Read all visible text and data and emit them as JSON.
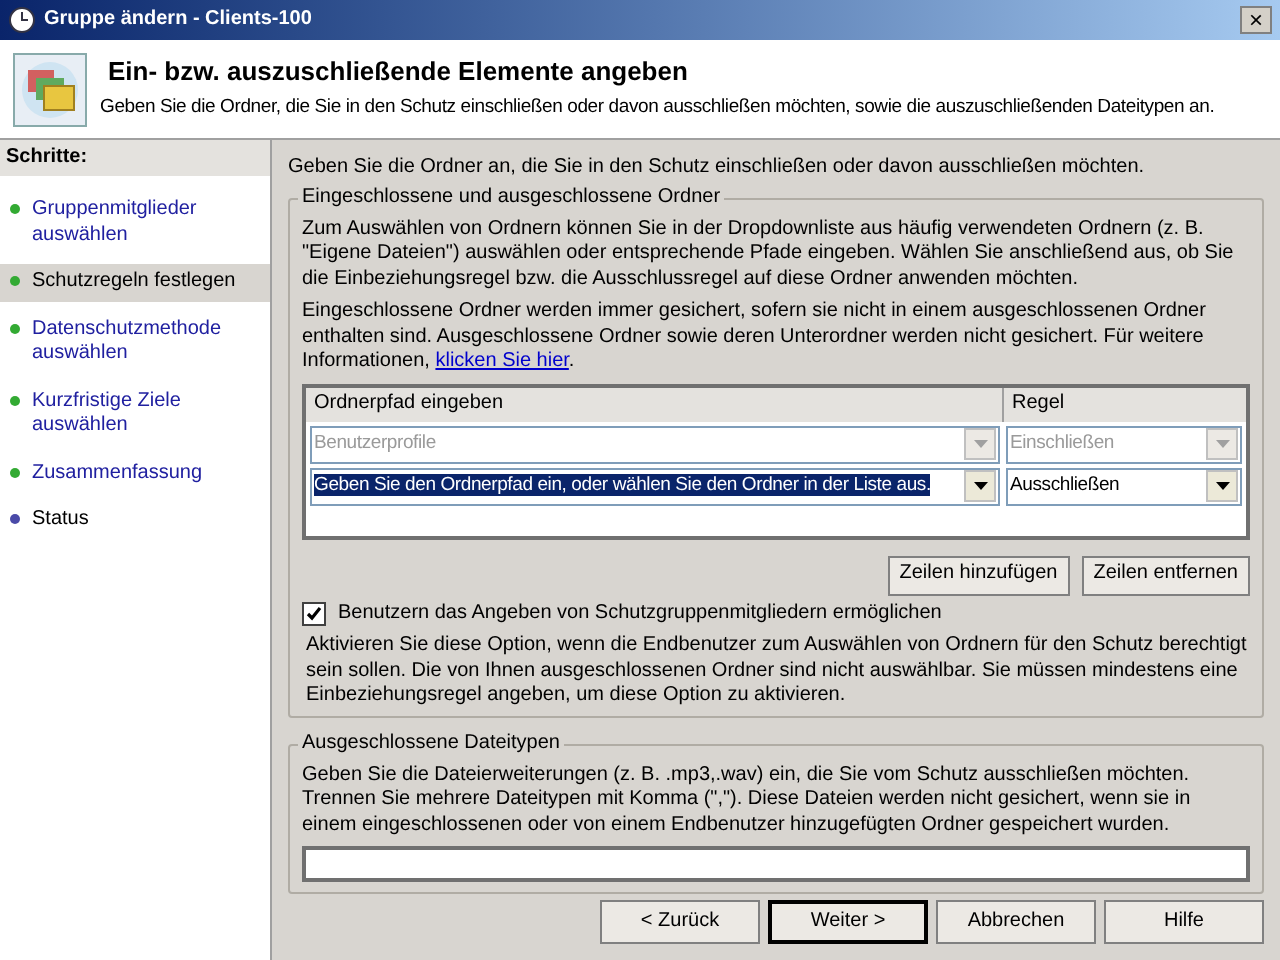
{
  "window": {
    "title": "Gruppe ändern - Clients-100",
    "close": "×"
  },
  "header": {
    "title": "Ein- bzw. auszuschließende Elemente angeben",
    "subtitle": "Geben Sie die Ordner, die Sie in den Schutz einschließen oder davon ausschließen möchten, sowie die auszuschließenden Dateitypen an."
  },
  "sidebar": {
    "title": "Schritte:",
    "items": [
      {
        "label": "Gruppenmitglieder auswählen",
        "selected": false,
        "link": true,
        "color": "#33aa33"
      },
      {
        "label": "Schutzregeln festlegen",
        "selected": true,
        "link": false,
        "color": "#33aa33"
      },
      {
        "label": "Datenschutzmethode auswählen",
        "selected": false,
        "link": true,
        "color": "#33aa33"
      },
      {
        "label": "Kurzfristige Ziele auswählen",
        "selected": false,
        "link": true,
        "color": "#33aa33"
      },
      {
        "label": "Zusammenfassung",
        "selected": false,
        "link": true,
        "color": "#33aa33"
      },
      {
        "label": "Status",
        "selected": false,
        "link": false,
        "color": "#4a4aa8"
      }
    ]
  },
  "intro": "Geben Sie die Ordner an, die Sie in den Schutz einschließen oder davon ausschließen möchten.",
  "folders_group": {
    "title": "Eingeschlossene und ausgeschlossene Ordner",
    "paragraph_1": "Zum Auswählen von Ordnern können Sie in der Dropdownliste aus häufig verwendeten Ordnern (z. B. \"Eigene Dateien\") auswählen oder entsprechende Pfade eingeben. Wählen Sie anschließend aus, ob Sie die Einbeziehungsregel bzw. die Ausschlussregel auf diese Ordner anwenden möchten.",
    "paragraph_2": "Eingeschlossene Ordner werden immer gesichert, sofern sie nicht in einem ausgeschlossenen Ordner enthalten sind. Ausgeschlossene Ordner sowie deren Unterordner werden nicht gesichert. Für weitere Informationen,",
    "link": "klicken Sie hier",
    "link_after": ".",
    "table": {
      "columns": [
        "Ordnerpfad eingeben",
        "Regel"
      ],
      "rows": [
        {
          "path": "Benutzerprofile",
          "rule": "Einschließen",
          "disabled": true,
          "selected": false
        },
        {
          "path": "Geben Sie den Ordnerpfad ein, oder wählen Sie den Ordner in der Liste aus.",
          "rule": "Ausschließen",
          "disabled": false,
          "selected": true
        }
      ]
    },
    "buttons": [
      "Zeilen hinzufügen",
      "Zeilen entfernen"
    ],
    "checkbox": {
      "label": "Benutzern das Angeben von Schutzgruppenmitgliedern ermöglichen",
      "checked": true
    },
    "note": "Aktivieren Sie diese Option, wenn die Endbenutzer zum Auswählen von Ordnern für den Schutz berechtigt sein sollen. Die von Ihnen ausgeschlossenen Ordner sind nicht auswählbar. Sie müssen mindestens eine Einbeziehungsregel angeben, um diese Option zu aktivieren."
  },
  "filetypes_group": {
    "title": "Ausgeschlossene Dateitypen",
    "text": "Geben Sie die Dateierweiterungen (z. B. .mp3,.wav) ein, die Sie vom Schutz ausschließen möchten. Trennen Sie mehrere Dateitypen mit Komma (\",\"). Diese Dateien werden nicht gesichert, wenn sie in einem eingeschlossenen oder von einem Endbenutzer hinzugefügten Ordner gespeichert wurden."
  },
  "footer_buttons": [
    {
      "label": "< Zurück",
      "default": false
    },
    {
      "label": "Weiter >",
      "default": true
    },
    {
      "label": "Abbrechen",
      "default": false
    },
    {
      "label": "Hilfe",
      "default": false
    }
  ]
}
